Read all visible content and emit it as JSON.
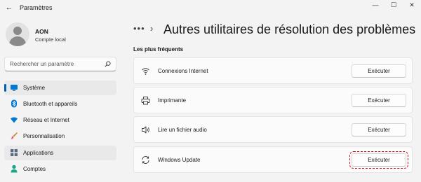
{
  "window": {
    "title": "Paramètres",
    "controls": {
      "minimize": "—",
      "maximize": "☐",
      "close": "✕"
    },
    "back_glyph": "←"
  },
  "profile": {
    "name": "AON",
    "subtitle": "Compte local"
  },
  "search": {
    "placeholder": "Rechercher un paramètre"
  },
  "sidebar": {
    "items": [
      {
        "label": "Système",
        "icon": "monitor-icon",
        "active": true
      },
      {
        "label": "Bluetooth et appareils",
        "icon": "bluetooth-icon"
      },
      {
        "label": "Réseau et Internet",
        "icon": "wifi-icon"
      },
      {
        "label": "Personnalisation",
        "icon": "brush-icon"
      },
      {
        "label": "Applications",
        "icon": "apps-icon",
        "hover": true
      },
      {
        "label": "Comptes",
        "icon": "person-icon"
      }
    ]
  },
  "main": {
    "breadcrumb_more": "•••",
    "breadcrumb_separator": "›",
    "page_title": "Autres utilitaires de résolution des problèmes",
    "section_title": "Les plus fréquents",
    "troubleshooters": [
      {
        "label": "Connexions Internet",
        "icon": "wifi-signal-icon",
        "button": "Exécuter"
      },
      {
        "label": "Imprimante",
        "icon": "printer-icon",
        "button": "Exécuter"
      },
      {
        "label": "Lire un fichier audio",
        "icon": "speaker-icon",
        "button": "Exécuter"
      },
      {
        "label": "Windows Update",
        "icon": "refresh-icon",
        "button": "Exécuter",
        "highlighted": true
      }
    ]
  },
  "colors": {
    "accent": "#005fb8",
    "highlight_border": "#d0121b",
    "background": "#f3f3f3",
    "card": "#fbfbfb"
  }
}
